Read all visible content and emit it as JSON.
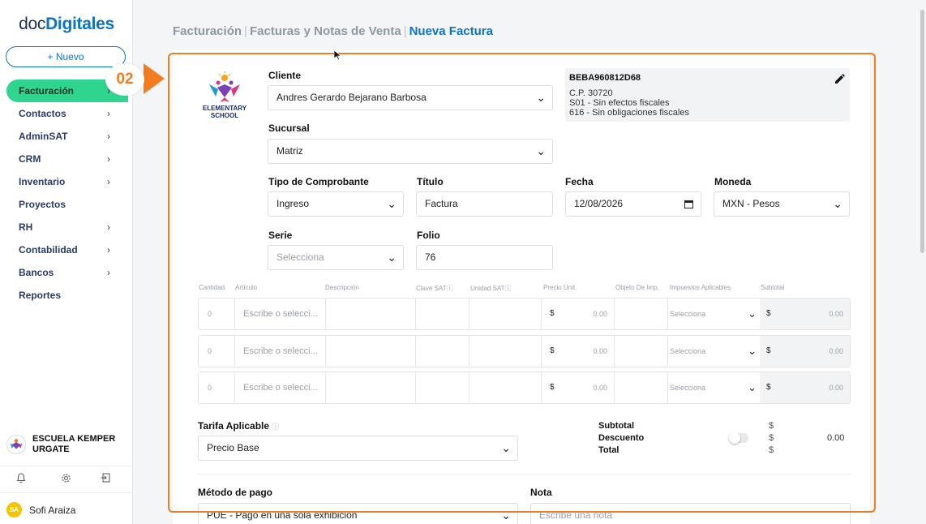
{
  "sidebar": {
    "logo_part1": "doc",
    "logo_part2": "Digitales",
    "new_button": "+ Nuevo",
    "items": [
      {
        "label": "Facturación",
        "chevron": true
      },
      {
        "label": "Contactos",
        "chevron": true
      },
      {
        "label": "AdminSAT",
        "chevron": true
      },
      {
        "label": "CRM",
        "chevron": true
      },
      {
        "label": "Inventario",
        "chevron": true
      },
      {
        "label": "Proyectos",
        "chevron": false
      },
      {
        "label": "RH",
        "chevron": true
      },
      {
        "label": "Contabilidad",
        "chevron": true
      },
      {
        "label": "Bancos",
        "chevron": true
      },
      {
        "label": "Reportes",
        "chevron": false
      }
    ],
    "active_index": 0,
    "company_name": "ESCUELA KEMPER URGATE",
    "user_initials": "SA",
    "user_name": "Sofi Araiza",
    "icons": [
      "bell-icon",
      "gear-icon",
      "logout-icon"
    ]
  },
  "breadcrumb": {
    "part1": "Facturación",
    "part2": "Facturas y Notas de Venta",
    "current": "Nueva Factura",
    "separator": "|"
  },
  "annotation": {
    "step": "02",
    "color": "#f07d22"
  },
  "form": {
    "school_logo_text_1": "ELEMENTARY",
    "school_logo_text_2": "SCHOOL",
    "cliente_label": "Cliente",
    "cliente_value": "Andres Gerardo Bejarano Barbosa",
    "sucursal_label": "Sucursal",
    "sucursal_value": "Matriz",
    "tipo_label": "Tipo de Comprobante",
    "tipo_value": "Ingreso",
    "titulo_label": "Título",
    "titulo_value": "Factura",
    "fecha_label": "Fecha",
    "fecha_value": "12/08/2026",
    "moneda_label": "Moneda",
    "moneda_value": "MXN - Pesos",
    "serie_label": "Serie",
    "serie_placeholder": "Selecciona",
    "folio_label": "Folio",
    "folio_value": "76"
  },
  "client_info": {
    "rfc": "BEBA960812D68",
    "cp": "C.P. 30720",
    "regimen_1": "S01 - Sin efectos fiscales",
    "regimen_2": "616 - Sin obligaciones fiscales"
  },
  "items_table": {
    "headers": [
      "Cantidad",
      "Artículo",
      "Descripción",
      "Clave SAT",
      "Unidad SAT",
      "Precio Unit.",
      "Objeto De Imp.",
      "Impuestos Aplicables",
      "Subtotal"
    ],
    "info_icon": "ⓘ",
    "rows": [
      {
        "cantidad": "0",
        "articulo_placeholder": "Escribe o selecci...",
        "currency": "$",
        "precio": "0.00",
        "impuestos_placeholder": "Selecciona",
        "subtotal": "0.00"
      },
      {
        "cantidad": "0",
        "articulo_placeholder": "Escribe o selecci...",
        "currency": "$",
        "precio": "0.00",
        "impuestos_placeholder": "Selecciona",
        "subtotal": "0.00"
      },
      {
        "cantidad": "0",
        "articulo_placeholder": "Escribe o selecci...",
        "currency": "$",
        "precio": "0.00",
        "impuestos_placeholder": "Selecciona",
        "subtotal": "0.00"
      }
    ]
  },
  "tarifa": {
    "label": "Tarifa Aplicable",
    "value": "Precio Base"
  },
  "totals": {
    "subtotal_label": "Subtotal",
    "descuento_label": "Descuento",
    "total_label": "Total",
    "currency": "$",
    "descuento_value": "0.00"
  },
  "payment": {
    "metodo_label": "Método de pago",
    "metodo_value": "PUE - Pago en una sola exhibición",
    "nota_label": "Nota",
    "nota_placeholder": "Escribe una nota"
  }
}
